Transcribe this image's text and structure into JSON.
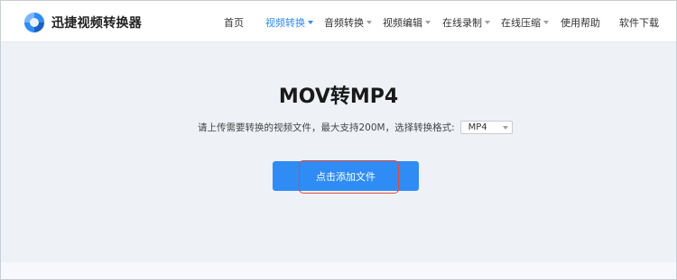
{
  "header": {
    "brand": "迅捷视频转换器",
    "nav": [
      {
        "label": "首页",
        "dropdown": false,
        "active": false
      },
      {
        "label": "视频转换",
        "dropdown": true,
        "active": true
      },
      {
        "label": "音频转换",
        "dropdown": true,
        "active": false
      },
      {
        "label": "视频编辑",
        "dropdown": true,
        "active": false
      },
      {
        "label": "在线录制",
        "dropdown": true,
        "active": false
      },
      {
        "label": "在线压缩",
        "dropdown": true,
        "active": false
      },
      {
        "label": "使用帮助",
        "dropdown": false,
        "active": false
      },
      {
        "label": "软件下载",
        "dropdown": false,
        "active": false
      }
    ]
  },
  "main": {
    "title": "MOV转MP4",
    "hint": "请上传需要转换的视频文件，最大支持200M，选择转换格式:",
    "format_selected": "MP4",
    "upload_label": "点击添加文件"
  },
  "colors": {
    "accent": "#2f8cf5",
    "highlight_border": "#e0493a"
  }
}
